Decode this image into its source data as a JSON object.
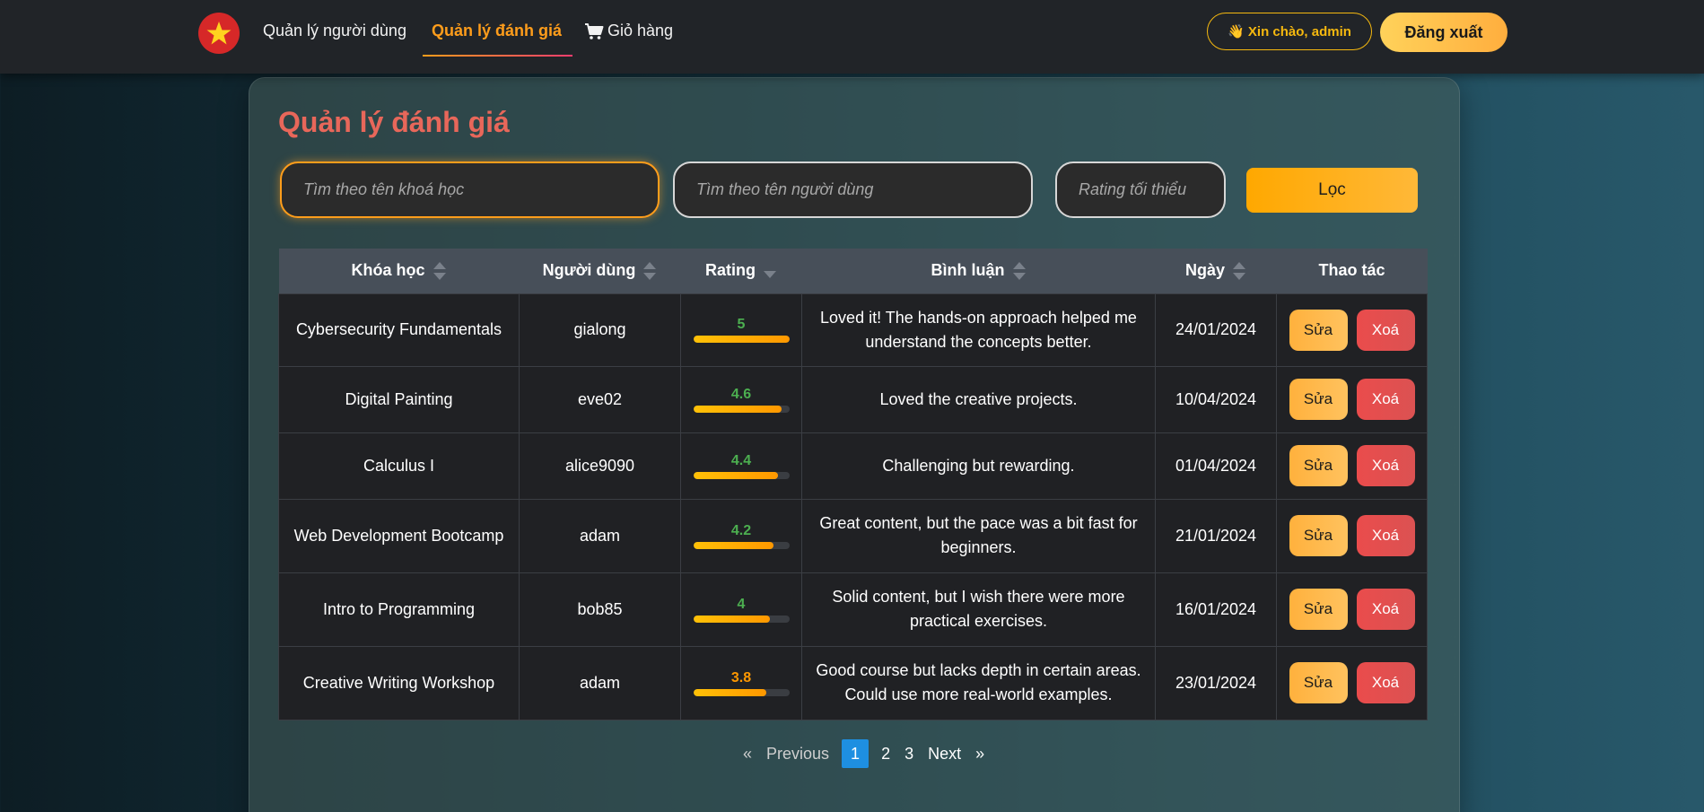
{
  "nav": {
    "users": "Quản lý người dùng",
    "reviews": "Quản lý đánh giá",
    "cart": "Giỏ hàng",
    "greeting": "👋 Xin chào, admin",
    "logout": "Đăng xuất"
  },
  "page": {
    "title": "Quản lý đánh giá"
  },
  "filters": {
    "course_placeholder": "Tìm theo tên khoá học",
    "user_placeholder": "Tìm theo tên người dùng",
    "rating_placeholder": "Rating tối thiểu",
    "button": "Lọc"
  },
  "table": {
    "headers": {
      "course": "Khóa học",
      "user": "Người dùng",
      "rating": "Rating",
      "comment": "Bình luận",
      "date": "Ngày",
      "actions": "Thao tác"
    },
    "edit_label": "Sửa",
    "delete_label": "Xoá",
    "rows": [
      {
        "course": "Cybersecurity Fundamentals",
        "user": "gialong",
        "rating": "5",
        "rating_value": 5,
        "rating_color": "#4caf50",
        "comment": "Loved it! The hands-on approach helped me understand the concepts better.",
        "date": "24/01/2024"
      },
      {
        "course": "Digital Painting",
        "user": "eve02",
        "rating": "4.6",
        "rating_value": 4.6,
        "rating_color": "#4caf50",
        "comment": "Loved the creative projects.",
        "date": "10/04/2024"
      },
      {
        "course": "Calculus I",
        "user": "alice9090",
        "rating": "4.4",
        "rating_value": 4.4,
        "rating_color": "#4caf50",
        "comment": "Challenging but rewarding.",
        "date": "01/04/2024"
      },
      {
        "course": "Web Development Bootcamp",
        "user": "adam",
        "rating": "4.2",
        "rating_value": 4.2,
        "rating_color": "#4caf50",
        "comment": "Great content, but the pace was a bit fast for beginners.",
        "date": "21/01/2024"
      },
      {
        "course": "Intro to Programming",
        "user": "bob85",
        "rating": "4",
        "rating_value": 4,
        "rating_color": "#4caf50",
        "comment": "Solid content, but I wish there were more practical exercises.",
        "date": "16/01/2024"
      },
      {
        "course": "Creative Writing Workshop",
        "user": "adam",
        "rating": "3.8",
        "rating_value": 3.8,
        "rating_color": "#ff9800",
        "comment": "Good course but lacks depth in certain areas. Could use more real-world examples.",
        "date": "23/01/2024"
      }
    ]
  },
  "pagination": {
    "first": "«",
    "prev": "Previous",
    "pages": [
      "1",
      "2",
      "3"
    ],
    "next": "Next",
    "last": "»"
  },
  "colors": {
    "accent": "#ff9d1b",
    "title": "#e8675a",
    "active_page": "#1e8fe1"
  }
}
